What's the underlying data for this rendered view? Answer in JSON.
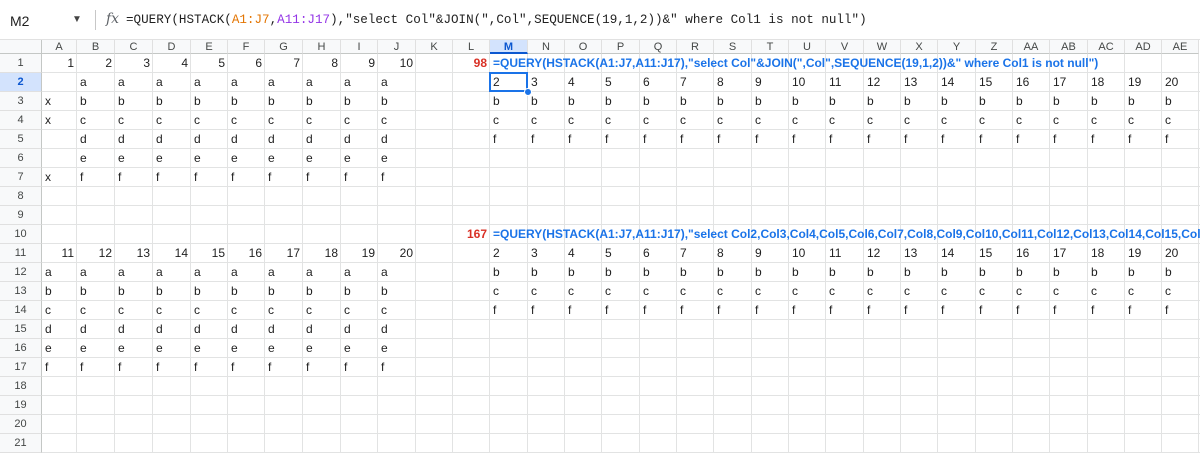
{
  "name_box": {
    "value": "M2"
  },
  "formula_bar": {
    "fx_icon": "fx",
    "formula": "=QUERY(HSTACK(A1:J7,A11:J17),\"select Col\"&JOIN(\",Col\",SEQUENCE(19,1,2))&\" where Col1 is not null\")"
  },
  "columns": [
    "A",
    "B",
    "C",
    "D",
    "E",
    "F",
    "G",
    "H",
    "I",
    "J",
    "K",
    "L",
    "M",
    "N",
    "O",
    "P",
    "Q",
    "R",
    "S",
    "T",
    "U",
    "V",
    "W",
    "X",
    "Y",
    "Z",
    "AA",
    "AB",
    "AC",
    "AD",
    "AE"
  ],
  "selected_column": "M",
  "rows": [
    "1",
    "2",
    "3",
    "4",
    "5",
    "6",
    "7",
    "8",
    "9",
    "10",
    "11",
    "12",
    "13",
    "14",
    "15",
    "16",
    "17",
    "18",
    "19",
    "20",
    "21"
  ],
  "selected_row": "2",
  "row1": [
    "1",
    "2",
    "3",
    "4",
    "5",
    "6",
    "7",
    "8",
    "9",
    "10"
  ],
  "row11": [
    "11",
    "12",
    "13",
    "14",
    "15",
    "16",
    "17",
    "18",
    "19",
    "20"
  ],
  "block1_col_a": [
    "",
    "x",
    "x",
    "",
    "",
    "x"
  ],
  "block1_letters": [
    "a",
    "b",
    "c",
    "d",
    "e",
    "f"
  ],
  "block2_col_a": [
    "a",
    "b",
    "c",
    "d",
    "e",
    "f"
  ],
  "block2_letters": [
    "a",
    "b",
    "c",
    "d",
    "e",
    "f"
  ],
  "result1": {
    "char_count": "98",
    "formula_text": "=QUERY(HSTACK(A1:J7,A11:J17),\"select Col\"&JOIN(\",Col\",SEQUENCE(19,1,2))&\" where Col1 is not null\")",
    "header": [
      "2",
      "3",
      "4",
      "5",
      "6",
      "7",
      "8",
      "9",
      "10",
      "11",
      "12",
      "13",
      "14",
      "15",
      "16",
      "17",
      "18",
      "19",
      "20"
    ],
    "rows": [
      "b",
      "c",
      "f"
    ]
  },
  "result2": {
    "char_count": "167",
    "formula_text": "=QUERY(HSTACK(A1:J7,A11:J17),\"select Col2,Col3,Col4,Col5,Col6,Col7,Col8,Col9,Col10,Col11,Col12,Col13,Col14,Col15,Col",
    "header": [
      "2",
      "3",
      "4",
      "5",
      "6",
      "7",
      "8",
      "9",
      "10",
      "11",
      "12",
      "13",
      "14",
      "15",
      "16",
      "17",
      "18",
      "19",
      "20"
    ],
    "rows": [
      "b",
      "c",
      "f"
    ]
  }
}
